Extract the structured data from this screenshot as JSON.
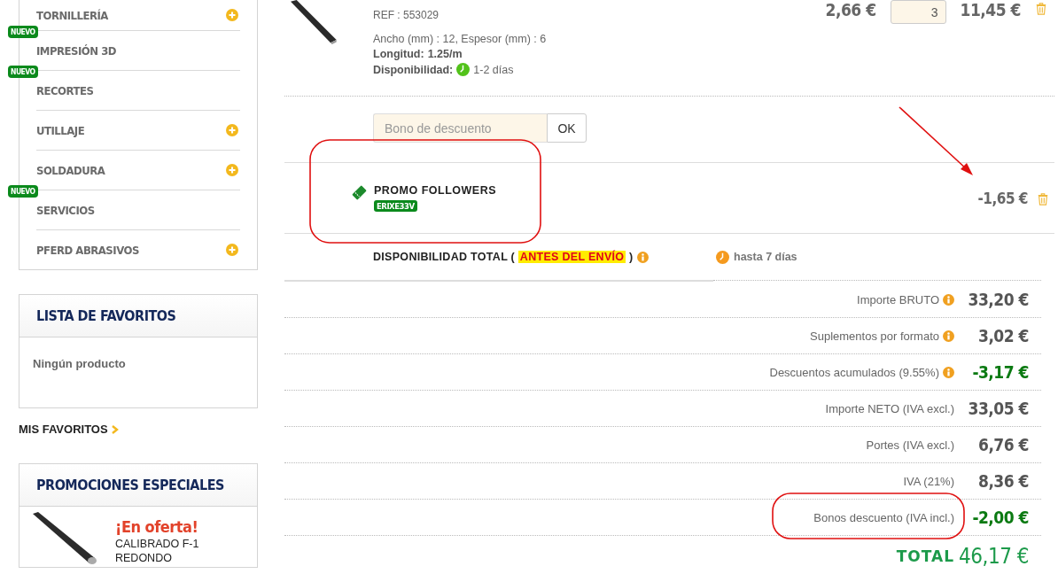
{
  "sidebar": {
    "menu": [
      {
        "label": "TORNILLERÍA",
        "expandable": true
      },
      {
        "label": "IMPRESIÓN 3D",
        "badge": "NUEVO",
        "expandable": false
      },
      {
        "label": "RECORTES",
        "badge": "NUEVO",
        "expandable": false
      },
      {
        "label": "UTILLAJE",
        "expandable": true
      },
      {
        "label": "SOLDADURA",
        "expandable": true
      },
      {
        "label": "SERVICIOS",
        "badge": "NUEVO",
        "expandable": false
      },
      {
        "label": "PFERD ABRASIVOS",
        "expandable": true
      }
    ],
    "favorites": {
      "title": "LISTA DE FAVORITOS",
      "empty_text": "Ningún producto",
      "link": "MIS FAVORITOS"
    },
    "promotions": {
      "title": "PROMOCIONES ESPECIALES",
      "items": [
        {
          "tag": "¡En oferta!",
          "name": "CALIBRADO F-1",
          "name_line_2": "REDONDO"
        }
      ]
    }
  },
  "cart": {
    "product": {
      "ref": "REF : 553029",
      "dimensions": "Ancho (mm) : 12, Espesor (mm) : 6",
      "length_label": "Longitud:",
      "length": "1.25/m",
      "availability_label": "Disponibilidad:",
      "availability": "1-2 días",
      "unit_price": "2,66 €",
      "quantity": "3",
      "total": "11,45 €"
    },
    "coupon": {
      "placeholder": "Bono de descuento",
      "button": "OK"
    },
    "promo": {
      "name": "PROMO FOLLOWERS",
      "code": "ERIXE33V",
      "amount": "-1,65 €"
    },
    "availability": {
      "label": "DISPONIBILIDAD TOTAL (",
      "highlight": "ANTES DEL ENVÍO",
      "close": ")",
      "time": "hasta 7 días"
    },
    "summary": [
      {
        "label": "Importe BRUTO",
        "info": true,
        "value": "33,20 €",
        "negative": false
      },
      {
        "label": "Suplementos por formato",
        "info": true,
        "value": "3,02 €",
        "negative": false
      },
      {
        "label": "Descuentos acumulados (9.55%)",
        "info": true,
        "value": "-3,17 €",
        "negative": true
      },
      {
        "label": "Importe NETO (IVA excl.)",
        "info": false,
        "value": "33,05 €",
        "negative": false
      },
      {
        "label": "Portes (IVA excl.)",
        "info": false,
        "value": "6,76 €",
        "negative": false
      },
      {
        "label": "IVA (21%)",
        "info": false,
        "value": "8,36 €",
        "negative": false
      },
      {
        "label": "Bonos descuento (IVA incl.)",
        "info": false,
        "value": "-2,00 €",
        "negative": true
      }
    ],
    "total": {
      "label": "TOTAL",
      "value": "46,17 €"
    }
  }
}
